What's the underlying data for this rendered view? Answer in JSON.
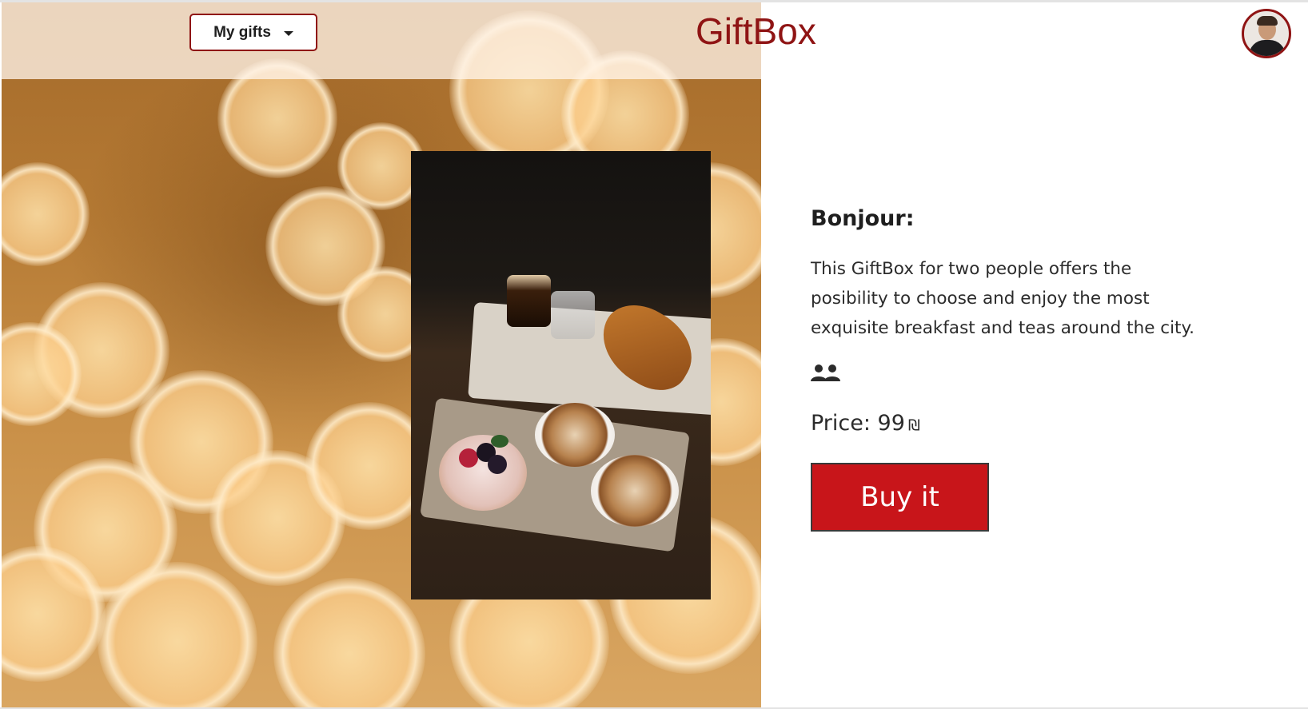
{
  "header": {
    "my_gifts_label": "My gifts",
    "brand_title": "GiftBox",
    "avatar_icon": "user-avatar-icon"
  },
  "product": {
    "name": "Bonjour:",
    "description": "This GiftBox for two people offers the posibility to choose and enjoy the most exquisite breakfast and teas around the city.",
    "people_icon": "two-people-icon",
    "price_label": "Price: 99",
    "currency_symbol": "₪",
    "buy_label": "Buy it"
  },
  "colors": {
    "brand": "#8f1414",
    "buy_button": "#c8151a",
    "text": "#2b2b2b"
  }
}
